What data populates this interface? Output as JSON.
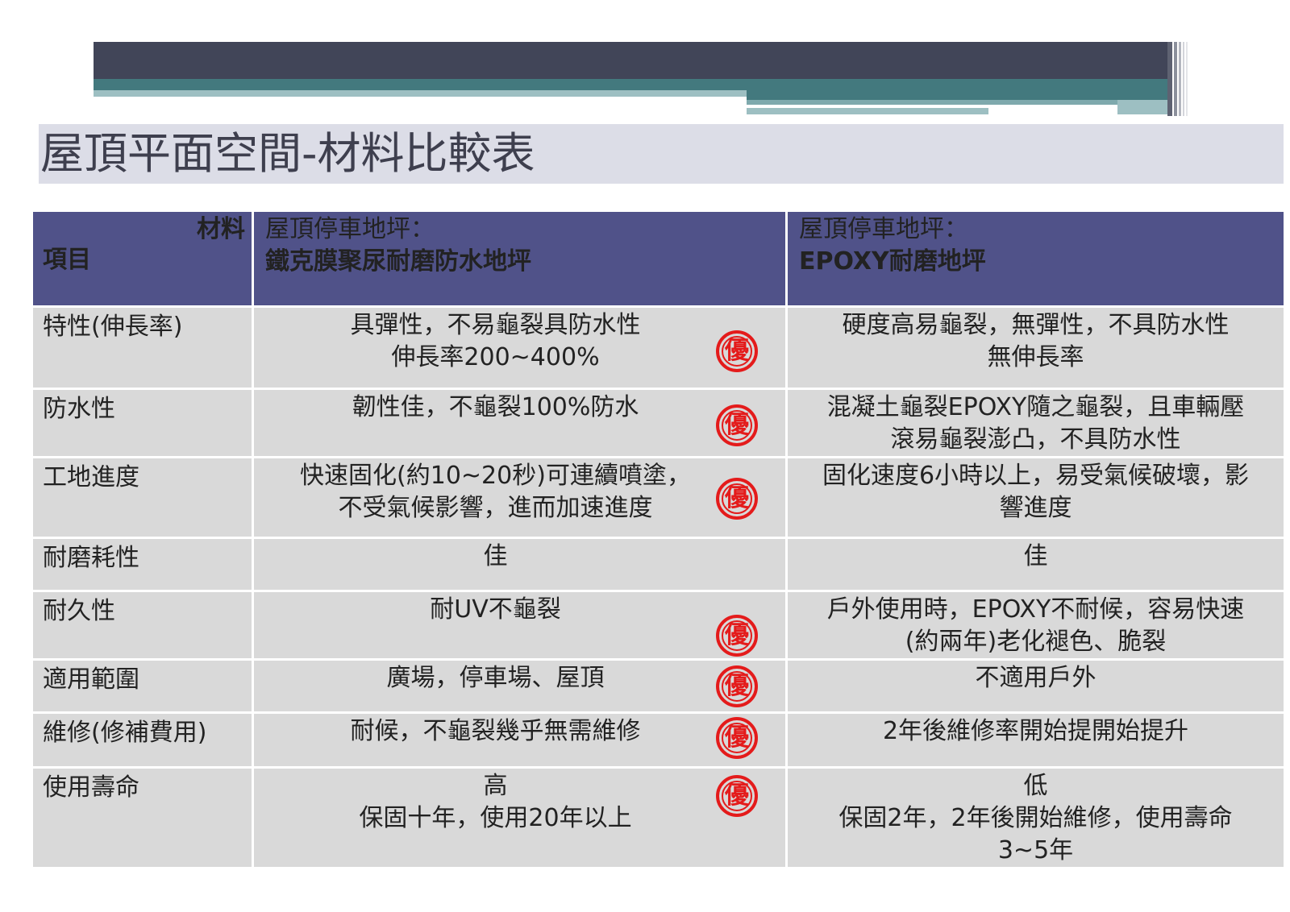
{
  "title": "屋頂平面空間-材料比較表",
  "header": {
    "corner_top": "材料",
    "corner_bottom": "項目",
    "col_a": {
      "line1": "屋頂停車地坪：",
      "line2": "鐵克膜聚尿耐磨防水地坪"
    },
    "col_b": {
      "line1": "屋頂停車地坪：",
      "line2": "EPOXY耐磨地坪"
    }
  },
  "badge_text": "優",
  "rows": [
    {
      "item": "特性(伸長率)",
      "a": [
        "具彈性，不易龜裂具防水性",
        "伸長率200~400%"
      ],
      "b": [
        "硬度高易龜裂，無彈性，不具防水性",
        "無伸長率"
      ],
      "a_better": true
    },
    {
      "item": "防水性",
      "a": [
        "韌性佳，不龜裂100%防水"
      ],
      "b": [
        "混凝土龜裂EPOXY隨之龜裂，且車輛壓",
        "滾易龜裂澎凸，不具防水性"
      ],
      "a_better": true
    },
    {
      "item": "工地進度",
      "a": [
        "快速固化(約10~20秒)可連續噴塗，",
        "不受氣候影響，進而加速進度"
      ],
      "b": [
        "固化速度6小時以上，易受氣候破壞，影",
        "響進度"
      ],
      "a_better": true
    },
    {
      "item": "耐磨耗性",
      "a": [
        "佳"
      ],
      "b": [
        "佳"
      ],
      "a_better": false
    },
    {
      "item": "耐久性",
      "a": [
        "耐UV不龜裂"
      ],
      "b": [
        "戶外使用時，EPOXY不耐候，容易快速",
        "(約兩年)老化褪色、脆裂"
      ],
      "a_better": true
    },
    {
      "item": "適用範圍",
      "a": [
        "廣場，停車場、屋頂"
      ],
      "b": [
        "不適用戶外"
      ],
      "a_better": true
    },
    {
      "item": "維修(修補費用)",
      "a": [
        "耐候，不龜裂幾乎無需維修"
      ],
      "b": [
        "2年後維修率開始提開始提升"
      ],
      "a_better": true
    },
    {
      "item": "使用壽命",
      "a": [
        "高",
        "保固十年，使用20年以上"
      ],
      "b": [
        "低",
        "保固2年，2年後開始維修，使用壽命",
        "3~5年"
      ],
      "a_better": true
    }
  ],
  "colors": {
    "header_bg": "#505289",
    "cell_bg": "#d9d9d9",
    "badge": "#e41b1b",
    "title_band": "#dcdde7"
  }
}
